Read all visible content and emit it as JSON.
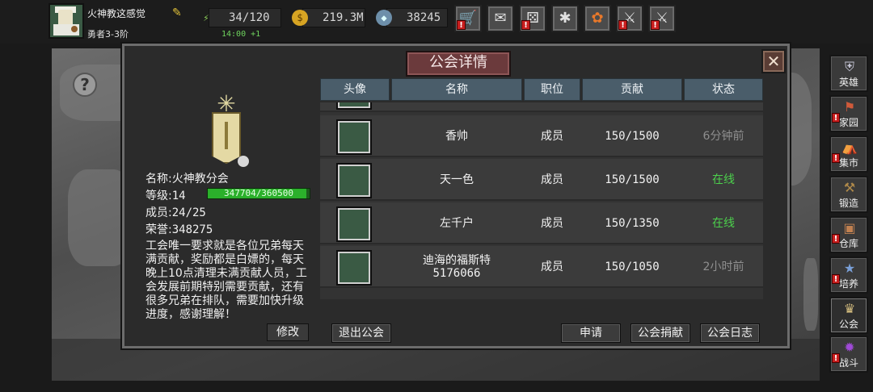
{
  "player": {
    "name": "火神教这感觉",
    "rank": "勇者3-3阶"
  },
  "resources": {
    "energy": "34/120",
    "energy_timer": "14:00 +1",
    "gold": "219.3M",
    "gems": "38245"
  },
  "top_buttons": [
    "shop",
    "mail",
    "gamepad",
    "settings",
    "event-wheel",
    "skill-1",
    "skill-2"
  ],
  "dialog": {
    "title": "公会详情",
    "guild": {
      "name_label": "名称:",
      "name_value": "火神教分会",
      "level_label": "等级:",
      "level_value": "14",
      "exp_text": "347704/360500",
      "exp_fraction": 0.9645,
      "members_label": "成员:",
      "members_value": "24/25",
      "honor_label": "荣誉:",
      "honor_value": "348275",
      "description": "工会唯一要求就是各位兄弟每天满贡献，奖励都是白嫖的，每天晚上10点清理未满贡献人员，工会发展前期特别需要贡献，还有很多兄弟在排队，需要加快升级进度，感谢理解！",
      "modify_label": "修改"
    },
    "table": {
      "headers": [
        "头像",
        "名称",
        "职位",
        "贡献",
        "状态"
      ],
      "rows": [
        {
          "name": "香帅",
          "position": "成员",
          "contribution": "150/1500",
          "status": "6分钟前"
        },
        {
          "name": "天一色",
          "position": "成员",
          "contribution": "150/1500",
          "status": "在线"
        },
        {
          "name": "左千户",
          "position": "成员",
          "contribution": "150/1350",
          "status": "在线"
        },
        {
          "name": "迪海的福斯特",
          "name_sub": "5176066",
          "position": "成员",
          "contribution": "150/1050",
          "status": "2小时前"
        }
      ]
    },
    "buttons": {
      "quit": "退出公会",
      "apply": "申请",
      "donate": "公会捐献",
      "log": "公会日志"
    }
  },
  "sidebar": {
    "items": [
      {
        "label": "英雄",
        "icon": "helmet-icon",
        "alert": false
      },
      {
        "label": "家园",
        "icon": "castle-icon",
        "alert": true
      },
      {
        "label": "集市",
        "icon": "market-icon",
        "alert": true
      },
      {
        "label": "锻造",
        "icon": "anvil-icon",
        "alert": false
      },
      {
        "label": "仓库",
        "icon": "warehouse-icon",
        "alert": true
      },
      {
        "label": "培养",
        "icon": "training-icon",
        "alert": true
      },
      {
        "label": "公会",
        "icon": "guild-icon",
        "alert": false
      },
      {
        "label": "战斗",
        "icon": "portal-icon",
        "alert": true
      }
    ]
  },
  "colors": {
    "online": "#4cd04c",
    "offline": "#8f8f8f",
    "alert": "#c81e1e",
    "header_bg": "#4a5d6a",
    "title_plate": "#6b3a3c"
  }
}
